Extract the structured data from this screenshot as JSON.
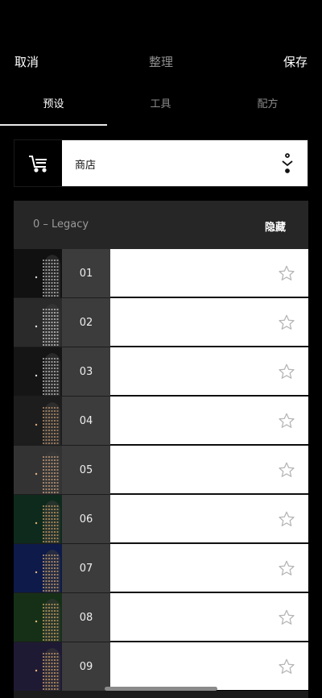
{
  "topbar": {
    "cancel": "取消",
    "title": "整理",
    "save": "保存"
  },
  "tabs": [
    {
      "label": "预设",
      "active": true
    },
    {
      "label": "工具",
      "active": false
    },
    {
      "label": "配方",
      "active": false
    }
  ],
  "store": {
    "label": "商店",
    "icon": "cart-icon",
    "menu_icon": "more-vertical-icon"
  },
  "group": {
    "name": "0 – Legacy",
    "hide_label": "隐藏"
  },
  "presets": [
    {
      "num": "01",
      "bg": "#111111",
      "light": "#d8d8d8"
    },
    {
      "num": "02",
      "bg": "#2a2a2a",
      "light": "#e6e6e6"
    },
    {
      "num": "03",
      "bg": "#151515",
      "light": "#dcdcdc"
    },
    {
      "num": "04",
      "bg": "#1d1d1d",
      "light": "#d9a77a"
    },
    {
      "num": "05",
      "bg": "#333333",
      "light": "#e3b28a"
    },
    {
      "num": "06",
      "bg": "#0e2a1c",
      "light": "#e2ad6e"
    },
    {
      "num": "07",
      "bg": "#0d1a4a",
      "light": "#e8b47c"
    },
    {
      "num": "08",
      "bg": "#163018",
      "light": "#e0b66b"
    },
    {
      "num": "09",
      "bg": "#1f1a34",
      "light": "#e9b276"
    }
  ],
  "colors": {
    "background": "#000000",
    "panel": "#1c1c1c",
    "number_cell": "#3c3c3c"
  }
}
